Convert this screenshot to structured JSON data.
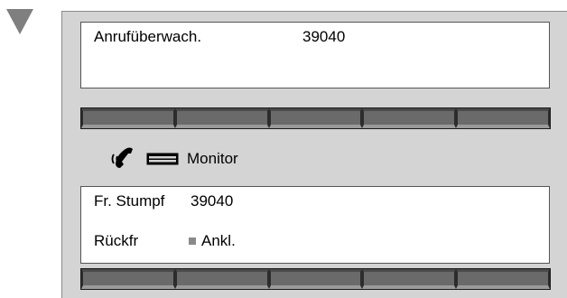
{
  "top_display": {
    "line1_left": "Anrufüberwach.",
    "line1_right": "39040"
  },
  "monitor": {
    "label": "Monitor",
    "icons": [
      "handset-icon",
      "monitor-key-icon"
    ]
  },
  "bottom_display": {
    "line1_name": "Fr. Stumpf",
    "line1_number": "39040",
    "line2_left": "Rückfr",
    "line2_right": "Ankl."
  },
  "softkeys_top_count": 5,
  "softkeys_bottom_count": 5,
  "colors": {
    "panel": "#d4d4d4",
    "softkey": "#6a6a6a",
    "indicator": "#7f7f7f",
    "led": "#8a8a8a"
  }
}
